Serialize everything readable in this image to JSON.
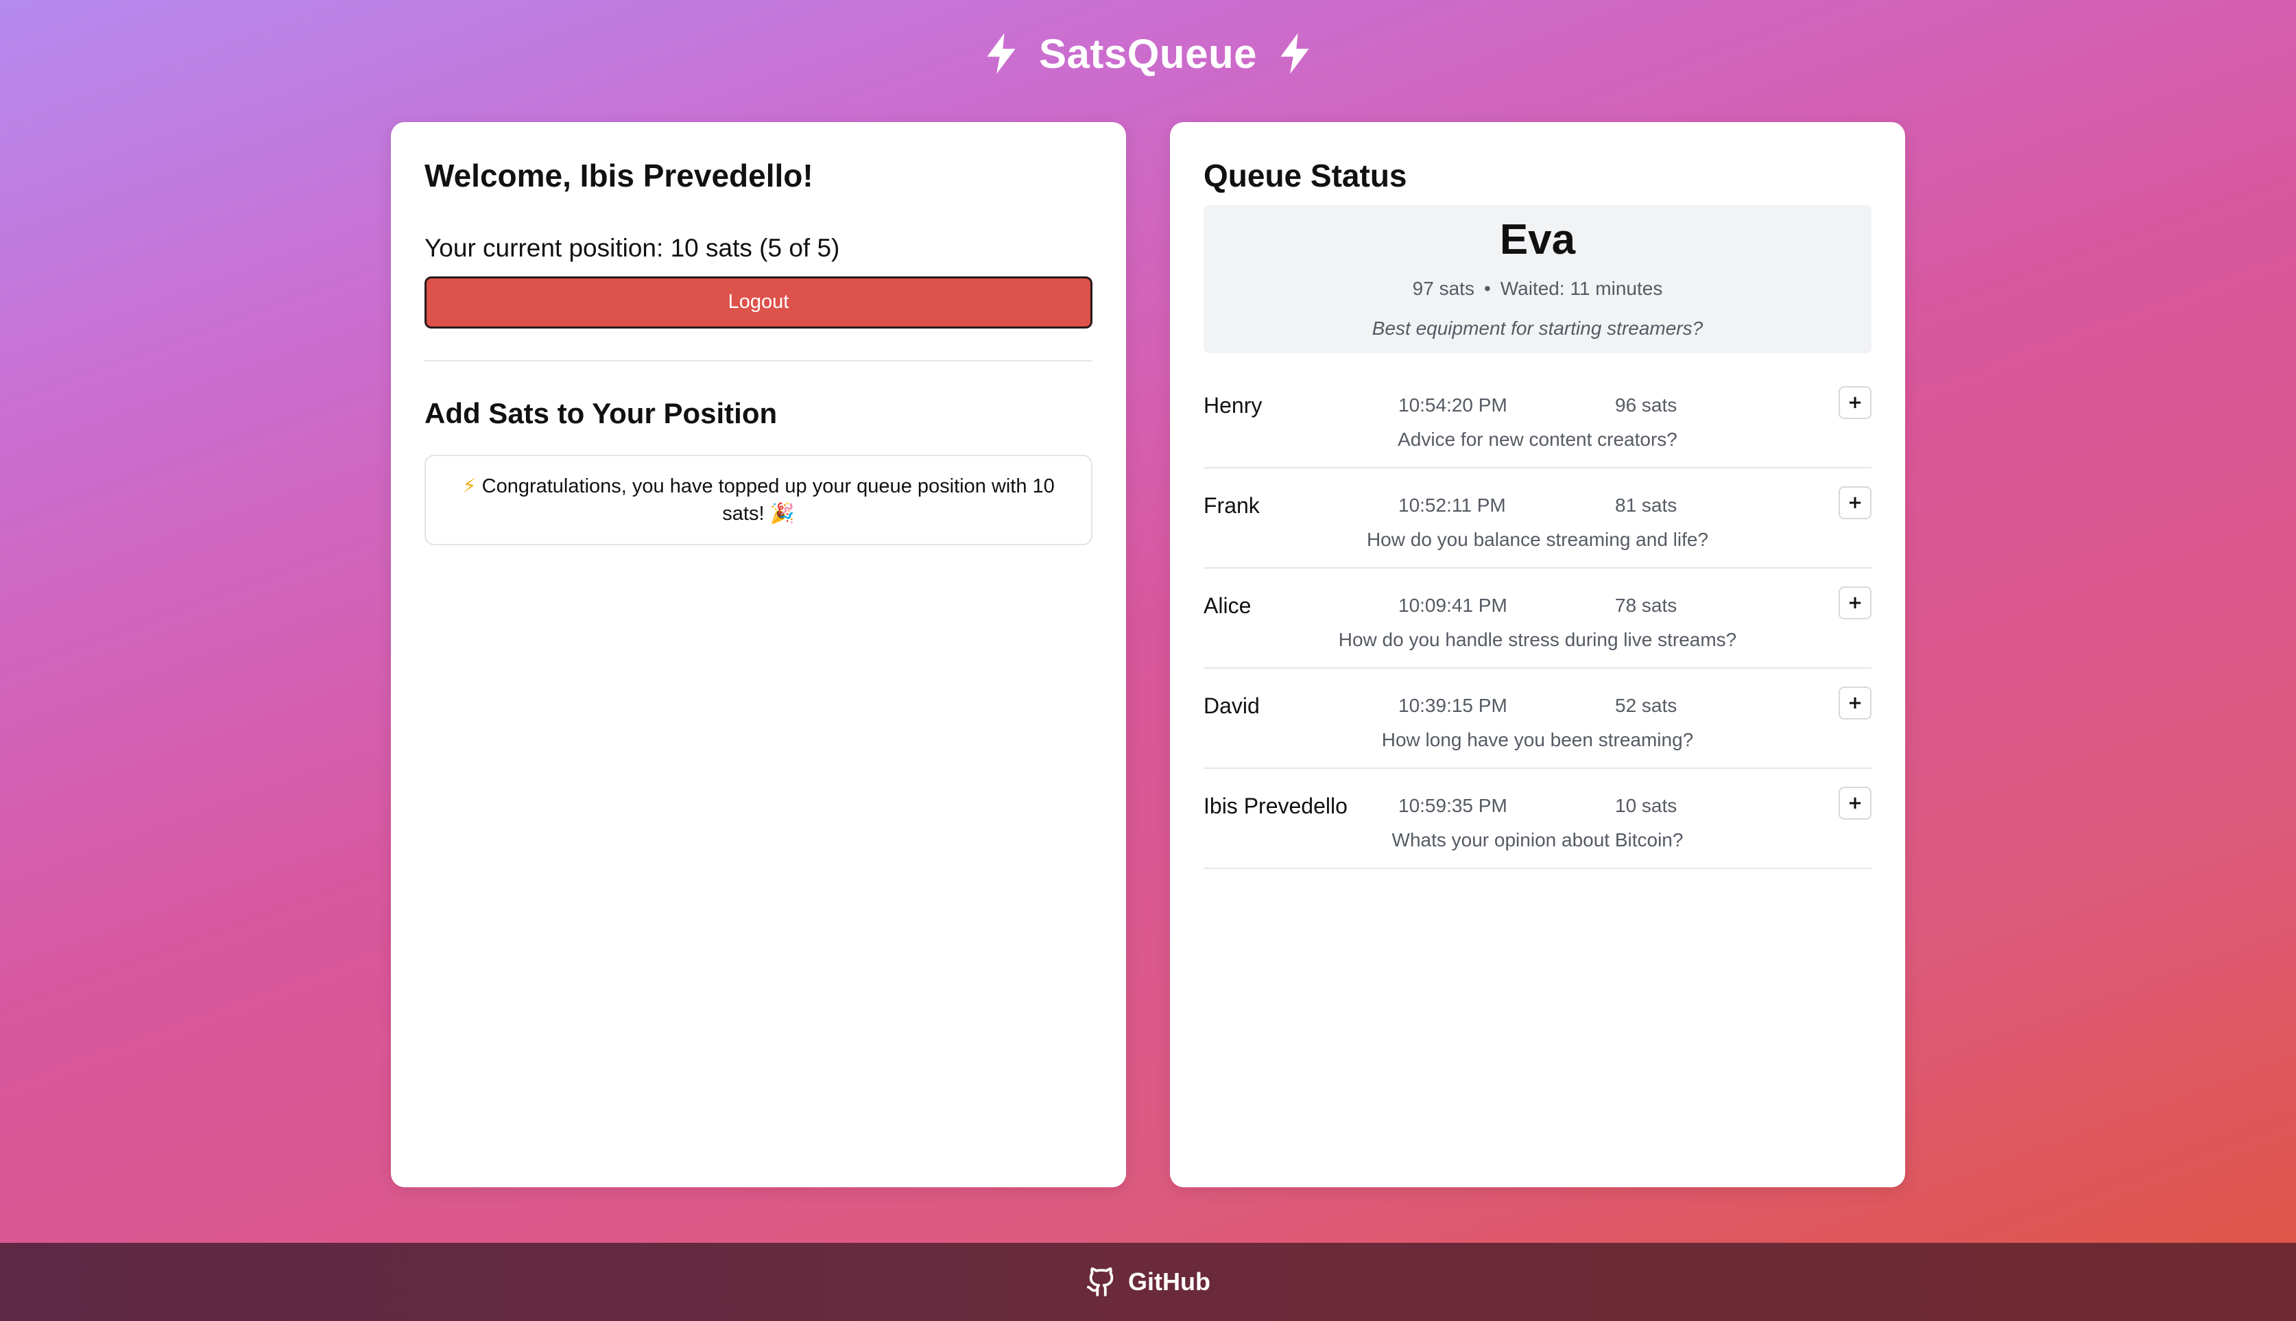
{
  "app": {
    "title": "SatsQueue"
  },
  "user": {
    "welcome": "Welcome, Ibis Prevedello!",
    "position_text": "Your current position: 10 sats (5 of 5)",
    "logout_label": "Logout"
  },
  "add_sats": {
    "title": "Add Sats to Your Position",
    "notice_icon": "⚡",
    "notice_text": " Congratulations, you have topped up your queue position with 10 sats! ",
    "notice_emoji": "🎉"
  },
  "queue": {
    "title": "Queue Status",
    "current": {
      "name": "Eva",
      "sats": "97 sats",
      "separator": "•",
      "waited": "Waited: 11 minutes",
      "question": "Best equipment for starting streamers?"
    },
    "items": [
      {
        "name": "Henry",
        "time": "10:54:20 PM",
        "sats": "96 sats",
        "question": "Advice for new content creators?",
        "action": "+"
      },
      {
        "name": "Frank",
        "time": "10:52:11 PM",
        "sats": "81 sats",
        "question": "How do you balance streaming and life?",
        "action": "+"
      },
      {
        "name": "Alice",
        "time": "10:09:41 PM",
        "sats": "78 sats",
        "question": "How do you handle stress during live streams?",
        "action": "+"
      },
      {
        "name": "David",
        "time": "10:39:15 PM",
        "sats": "52 sats",
        "question": "How long have you been streaming?",
        "action": "+"
      },
      {
        "name": "Ibis Prevedello",
        "time": "10:59:35 PM",
        "sats": "10 sats",
        "question": "Whats your opinion about Bitcoin?",
        "action": "+"
      }
    ]
  },
  "footer": {
    "github_label": "GitHub",
    "icon": "github-icon"
  },
  "colors": {
    "logout_button": "#dd524b",
    "footer_bg": "#6a2a3c",
    "accent_bolt": "#ffffff"
  }
}
